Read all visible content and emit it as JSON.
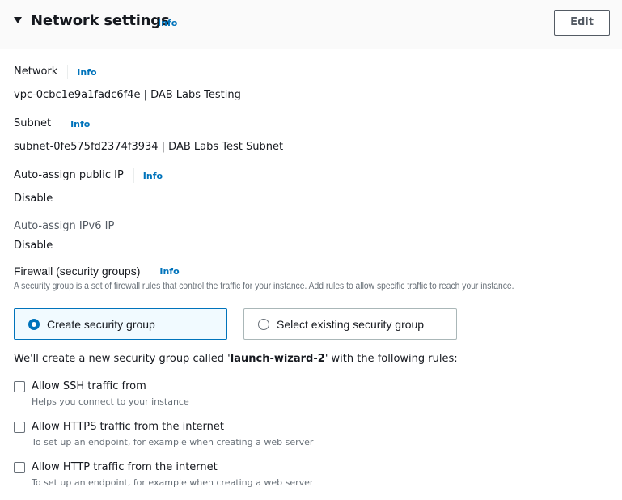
{
  "header": {
    "title": "Network settings",
    "info_label": "Info",
    "edit_label": "Edit"
  },
  "fields": {
    "network": {
      "label": "Network",
      "info": "Info",
      "value": "vpc-0cbc1e9a1fadc6f4e | DAB Labs Testing"
    },
    "subnet": {
      "label": "Subnet",
      "info": "Info",
      "value": "subnet-0fe575fd2374f3934 | DAB Labs Test Subnet"
    },
    "public_ip": {
      "label": "Auto-assign public IP",
      "info": "Info",
      "value": "Disable"
    },
    "ipv6": {
      "label": "Auto-assign IPv6 IP",
      "value": "Disable"
    }
  },
  "firewall": {
    "label": "Firewall (security groups)",
    "info": "Info",
    "description": "A security group is a set of firewall rules that control the traffic for your instance. Add rules to allow specific traffic to reach your instance.",
    "options": [
      {
        "label": "Create security group",
        "selected": true
      },
      {
        "label": "Select existing security group",
        "selected": false
      }
    ],
    "note_prefix": "We'll create a new security group called '",
    "note_name": "launch-wizard-2",
    "note_suffix": "' with the following rules:",
    "rules": [
      {
        "label": "Allow SSH traffic from",
        "description": "Helps you connect to your instance",
        "checked": false
      },
      {
        "label": "Allow HTTPS traffic from the internet",
        "description": "To set up an endpoint, for example when creating a web server",
        "checked": false
      },
      {
        "label": "Allow HTTP traffic from the internet",
        "description": "To set up an endpoint, for example when creating a web server",
        "checked": false
      }
    ]
  }
}
